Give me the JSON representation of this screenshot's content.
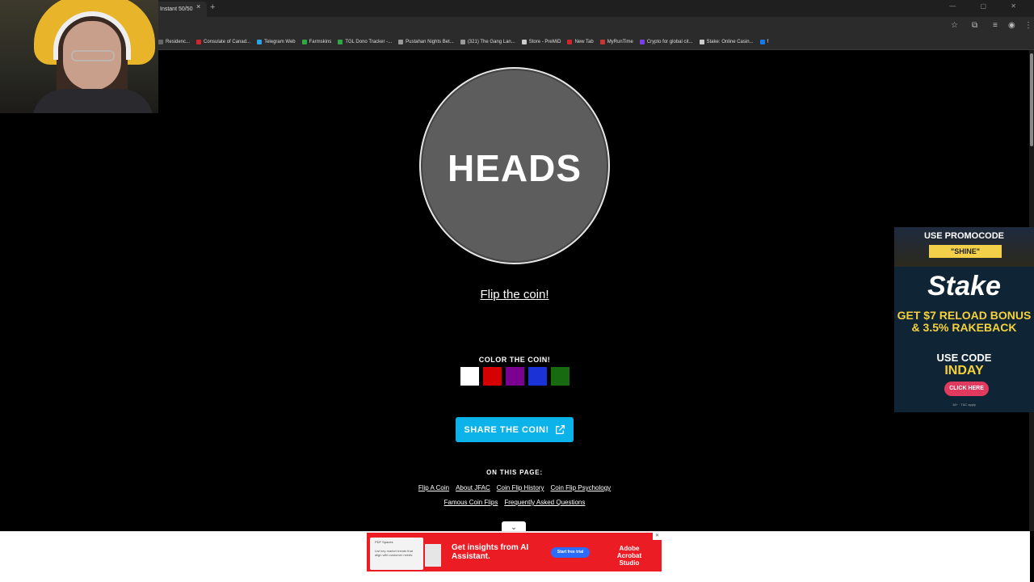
{
  "browser": {
    "tab_title": "Instant 50/50",
    "tab_close": "×",
    "new_tab": "+",
    "window_controls": "— ▢ ✕",
    "bookmarks": [
      {
        "label": "Residenc...",
        "color": "#666666"
      },
      {
        "label": "Consulate of Canad...",
        "color": "#d0252b"
      },
      {
        "label": "Telegram Web",
        "color": "#2aa3e0"
      },
      {
        "label": "Farmskins",
        "color": "#2fa844"
      },
      {
        "label": "TGL Dono Tracker -...",
        "color": "#2fa844"
      },
      {
        "label": "Pustahan Nights Bet...",
        "color": "#999999"
      },
      {
        "label": "(321) The Gang Lan...",
        "color": "#999999"
      },
      {
        "label": "Store - PreMiD",
        "color": "#cccccc"
      },
      {
        "label": "New Tab",
        "color": "#d0252b"
      },
      {
        "label": "MyRunTime",
        "color": "#cc3333"
      },
      {
        "label": "Crypto for global cit...",
        "color": "#7b3fe4"
      },
      {
        "label": "Stake: Online Casin...",
        "color": "#cccccc"
      },
      {
        "label": "f",
        "color": "#1877f2"
      }
    ]
  },
  "coin": {
    "face_text": "HEADS",
    "color": "#5d5d5d",
    "flip_label": "Flip the coin!"
  },
  "color_picker": {
    "label": "COLOR THE COIN!",
    "swatches": [
      {
        "name": "white",
        "color": "#ffffff"
      },
      {
        "name": "red",
        "color": "#d70000"
      },
      {
        "name": "purple",
        "color": "#7b0091"
      },
      {
        "name": "blue",
        "color": "#1b33d6"
      },
      {
        "name": "green",
        "color": "#176a10"
      }
    ]
  },
  "share": {
    "label": "SHARE THE COIN!",
    "icon": "external-link-icon",
    "color": "#0cb3ea"
  },
  "on_this_page": {
    "label": "ON THIS PAGE:",
    "row1": [
      "Flip A Coin",
      "About JFAC",
      "Coin Flip History",
      "Coin Flip Psychology"
    ],
    "row2": [
      "Famous Coin Flips",
      "Frequently Asked Questions"
    ]
  },
  "stake_ad": {
    "promo_line": "USE PROMOCODE",
    "promo_code": "\"SHINE\"",
    "logo": "Stake",
    "bonus": "GET $7 RELOAD BONUS & 3.5% RAKEBACK",
    "use_code": "USE CODE",
    "code": "INDAY",
    "button": "CLICK HERE",
    "fine_print": "18+ · T&C apply"
  },
  "adobe_ad": {
    "thumb_label": "PDF Spaces",
    "thumb_text": "List key market trends that align with customer needs.",
    "headline": "Get insights from AI Assistant.",
    "button": "Start free trial",
    "brand": "Adobe Acrobat Studio",
    "close": "✕"
  }
}
